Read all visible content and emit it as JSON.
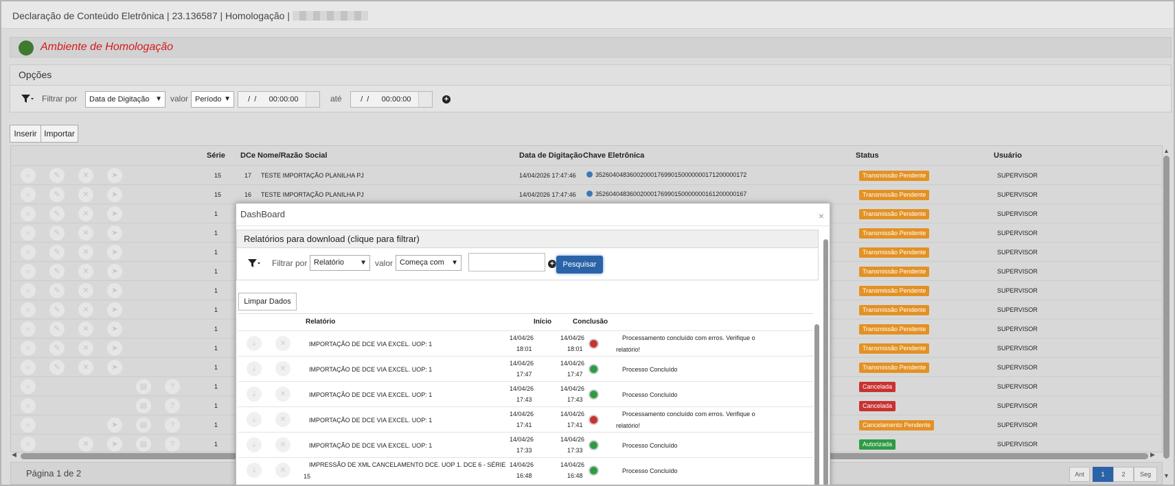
{
  "window": {
    "title": "Declaração de Conteúdo Eletrônica | 23.136587 | Homologação |"
  },
  "environment": {
    "label": "Ambiente de Homologação"
  },
  "options": {
    "title": "Opções",
    "filter_label": "Filtrar por",
    "filter_value": "Data de Digitação",
    "valor_label": "valor",
    "valor_value": "Período",
    "date_from": "  /  /      00:00:00",
    "ate_label": "até",
    "date_to": "  /  /      00:00:00"
  },
  "toolbar": {
    "insert": "Inserir",
    "import": "Importar"
  },
  "grid": {
    "headers": {
      "serie": "Série",
      "dce": "DCe",
      "nome": "Nome/Razão Social",
      "data": "Data de Digitação",
      "chave": "Chave Eletrônica",
      "status": "Status",
      "usuario": "Usuário"
    },
    "rows": [
      {
        "serie": "15",
        "dce": "17",
        "nome": "TESTE IMPORTAÇÃO PLANILHA PJ",
        "data": "14/04/2026 17:47:46",
        "chave": "35260404836002000176990150000000171200000172",
        "status": "Transmissão Pendente",
        "usuario": "SUPERVISOR"
      },
      {
        "serie": "15",
        "dce": "16",
        "nome": "TESTE IMPORTAÇÃO PLANILHA PJ",
        "data": "14/04/2026 17:47:46",
        "chave": "35260404836002000176990150000000161200000167",
        "status": "Transmissão Pendente",
        "usuario": "SUPERVISOR"
      },
      {
        "serie": "1",
        "status": "Transmissão Pendente",
        "usuario": "SUPERVISOR"
      },
      {
        "serie": "1",
        "status": "Transmissão Pendente",
        "usuario": "SUPERVISOR"
      },
      {
        "serie": "1",
        "status": "Transmissão Pendente",
        "usuario": "SUPERVISOR"
      },
      {
        "serie": "1",
        "status": "Transmissão Pendente",
        "usuario": "SUPERVISOR"
      },
      {
        "serie": "1",
        "status": "Transmissão Pendente",
        "usuario": "SUPERVISOR"
      },
      {
        "serie": "1",
        "status": "Transmissão Pendente",
        "usuario": "SUPERVISOR"
      },
      {
        "serie": "1",
        "status": "Transmissão Pendente",
        "usuario": "SUPERVISOR"
      },
      {
        "serie": "1",
        "status": "Transmissão Pendente",
        "usuario": "SUPERVISOR"
      },
      {
        "serie": "1",
        "status": "Transmissão Pendente",
        "usuario": "SUPERVISOR"
      },
      {
        "serie": "1",
        "status": "Cancelada",
        "usuario": "SUPERVISOR"
      },
      {
        "serie": "1",
        "status": "Cancelada",
        "usuario": "SUPERVISOR"
      },
      {
        "serie": "1",
        "status": "Cancelamento Pendente",
        "usuario": "SUPERVISOR"
      },
      {
        "serie": "1",
        "status": "Autorizada",
        "usuario": "SUPERVISOR"
      }
    ]
  },
  "pagination": {
    "text": "Página 1 de 2",
    "prev": "Ant",
    "pages": [
      "1",
      "2"
    ],
    "next": "Seg"
  },
  "modal": {
    "title": "DashBoard",
    "close": "×",
    "panel_title": "Relatórios para download (clique para filtrar)",
    "filter_label": "Filtrar por",
    "filter_value": "Relatório",
    "valor_label": "valor",
    "valor_value": "Começa com",
    "search_button": "Pesquisar",
    "clear_button": "Limpar Dados",
    "headers": {
      "relatorio": "Relatório",
      "inicio": "Início",
      "conclusao": "Conclusão"
    },
    "rows": [
      {
        "relatorio": "IMPORTAÇÃO DE DCE VIA EXCEL. UOP: 1",
        "inicio_d": "14/04/26",
        "inicio_t": "18:01",
        "concl_d": "14/04/26",
        "concl_t": "18:01",
        "status": "error",
        "msg1": "Processamento concluído com erros. Verifique o",
        "msg2": "relatório!"
      },
      {
        "relatorio": "IMPORTAÇÃO DE DCE VIA EXCEL. UOP: 1",
        "inicio_d": "14/04/26",
        "inicio_t": "17:47",
        "concl_d": "14/04/26",
        "concl_t": "17:47",
        "status": "ok",
        "msg1": "Processo Concluído",
        "msg2": ""
      },
      {
        "relatorio": "IMPORTAÇÃO DE DCE VIA EXCEL. UOP: 1",
        "inicio_d": "14/04/26",
        "inicio_t": "17:43",
        "concl_d": "14/04/26",
        "concl_t": "17:43",
        "status": "ok",
        "msg1": "Processo Concluído",
        "msg2": ""
      },
      {
        "relatorio": "IMPORTAÇÃO DE DCE VIA EXCEL. UOP: 1",
        "inicio_d": "14/04/26",
        "inicio_t": "17:41",
        "concl_d": "14/04/26",
        "concl_t": "17:41",
        "status": "error",
        "msg1": "Processamento concluído com erros. Verifique o",
        "msg2": "relatório!"
      },
      {
        "relatorio": "IMPORTAÇÃO DE DCE VIA EXCEL. UOP: 1",
        "inicio_d": "14/04/26",
        "inicio_t": "17:33",
        "concl_d": "14/04/26",
        "concl_t": "17:33",
        "status": "ok",
        "msg1": "Processo Concluído",
        "msg2": ""
      },
      {
        "relatorio": "IMPRESSÃO DE XML CANCELAMENTO DCE. UOP 1. DCE 6 - SÉRIE",
        "relatorio2": "15",
        "inicio_d": "14/04/26",
        "inicio_t": "16:48",
        "concl_d": "14/04/26",
        "concl_t": "16:48",
        "status": "ok",
        "msg1": "Processo Concluído",
        "msg2": ""
      }
    ]
  },
  "colors": {
    "pending": "#e39123",
    "cancelled": "#c8322f",
    "authorized": "#2e9b43",
    "accent": "#2b63a8",
    "env_text": "#d4181c"
  }
}
